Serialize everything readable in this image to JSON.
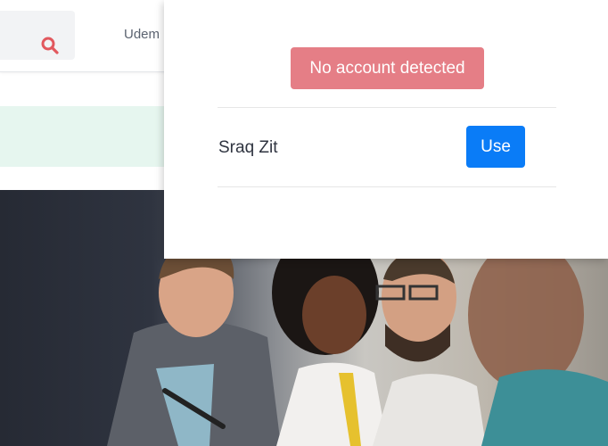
{
  "header": {
    "nav_link_label": "Udem",
    "search_icon": "search-icon"
  },
  "popup": {
    "status_badge": "No account detected",
    "accounts": [
      {
        "name": "Sraq Zit",
        "action_label": "Use"
      }
    ]
  },
  "colors": {
    "badge": "#e57e86",
    "use_button": "#0a7cf7",
    "search_icon": "#e2585e",
    "alert_strip": "#e6f6ef"
  }
}
